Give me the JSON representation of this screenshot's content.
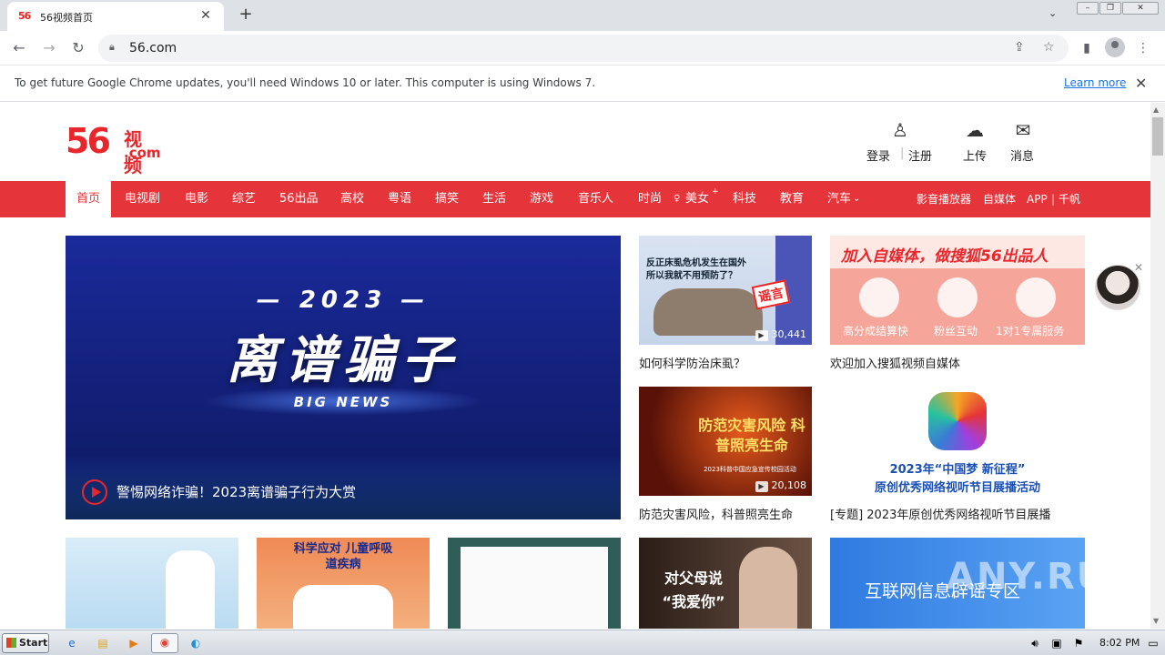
{
  "browser": {
    "tab_title": "56视频首页",
    "tab_favicon": "56",
    "url": "56.com",
    "new_tab": "+",
    "infobar": {
      "message": "To get future Google Chrome updates, you'll need Windows 10 or later. This computer is using Windows 7.",
      "link": "Learn more"
    }
  },
  "header": {
    "logo_number": "56",
    "logo_cn": "视频",
    "logo_com": ".com",
    "login": "登录",
    "register": "注册",
    "upload": "上传",
    "messages": "消息"
  },
  "nav": {
    "items": [
      "首页",
      "电视剧",
      "电影",
      "综艺",
      "56出品",
      "高校",
      "粤语",
      "搞笑",
      "生活",
      "游戏",
      "音乐人",
      "时尚",
      "美女",
      "科技",
      "教育",
      "汽车"
    ],
    "right": [
      "影音播放器",
      "自媒体",
      "APP",
      "千帆"
    ]
  },
  "hero": {
    "year": "— 2023 —",
    "headline": "离谱骗子",
    "sub": "BIG NEWS",
    "title": "警惕网络诈骗！2023离谱骗子行为大赏"
  },
  "cards": {
    "c1": {
      "title": "如何科学防治床虱？",
      "count": "30,441",
      "thumb_text": "反正床虱危机发生在国外 所以我就不用预防了？",
      "stamp": "谣言"
    },
    "c2": {
      "title": "欢迎加入搜狐视频自媒体",
      "thumb_top": "加入自媒体，做搜狐56出品人",
      "thumb_labels": [
        "高分成结算快",
        "粉丝互动",
        "1对1专属服务"
      ]
    },
    "c3": {
      "title": "防范灾害风险，科普照亮生命",
      "count": "20,108",
      "thumb_text": "防范灾害风险 科普照亮生命",
      "thumb_sub": "2023科普中国应急宣传校园活动"
    },
    "c4": {
      "title": "[专题] 2023年原创优秀网络视听节目展播",
      "thumb_text": "2023年“中国梦 新征程”",
      "thumb_sub": "原创优秀网络视听节目展播活动"
    }
  },
  "bottom": {
    "b2_text": "科学应对 儿童呼吸道疾病",
    "b4_text": "对父母说 “我爱你”",
    "b5_text": "互联网信息辟谣专区"
  },
  "watermark": "ANY.RUN",
  "taskbar": {
    "start": "Start",
    "time": "8:02 PM"
  }
}
